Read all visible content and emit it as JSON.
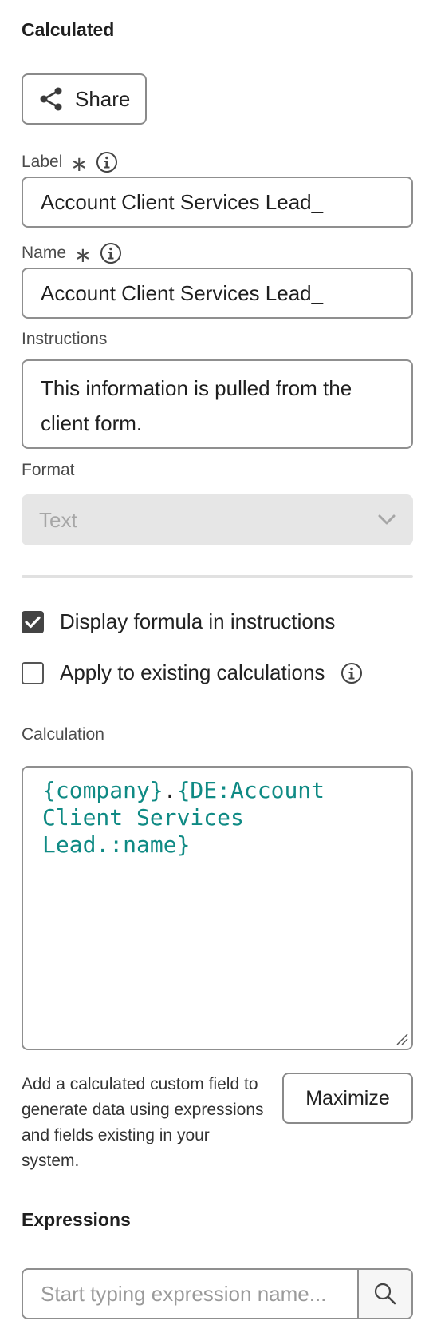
{
  "header": {
    "title": "Calculated"
  },
  "share": {
    "label": "Share",
    "icon": "share-icon"
  },
  "label_field": {
    "label": "Label",
    "required_mark": "∗",
    "value": "Account Client Services Lead_"
  },
  "name_field": {
    "label": "Name",
    "required_mark": "∗",
    "value": "Account Client Services Lead_"
  },
  "instructions_field": {
    "label": "Instructions",
    "value": "This information is pulled from the client form."
  },
  "format_field": {
    "label": "Format",
    "value": "Text",
    "disabled": true
  },
  "options": {
    "display_formula": {
      "label": "Display formula in instructions",
      "checked": true
    },
    "apply_existing": {
      "label": "Apply to existing calculations",
      "checked": false
    }
  },
  "calculation": {
    "label": "Calculation",
    "token_company": "{company}",
    "separator": ".",
    "token_field": "{DE:Account Client Services Lead.:name}"
  },
  "help": {
    "text": "Add a calculated custom field to generate data using expressions and fields existing in your system."
  },
  "maximize": {
    "label": "Maximize"
  },
  "expressions": {
    "title": "Expressions",
    "placeholder": "Start typing expression name..."
  },
  "colors": {
    "code_text": "#0f8a84",
    "checkbox_checked": "#444444",
    "disabled_bg": "#e6e6e6"
  }
}
